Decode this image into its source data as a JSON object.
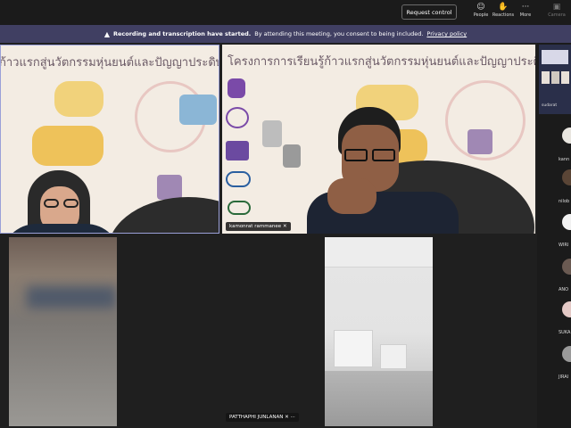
{
  "toolbar": {
    "request_control": "Request control",
    "people": "People",
    "reactions": "Reactions",
    "more": "More",
    "camera": "Camera"
  },
  "banner": {
    "bold_text": "Recording and transcription have started.",
    "text": "By attending this meeting, you consent to being included.",
    "link": "Privacy policy"
  },
  "slide_title": "โครงการการเรียนรู้ก้าวแรกสู่นวัตกรรมหุ่นยนต์และปัญญาประดิษฐ์",
  "slide_title_cropped": "ก้าวแรกสู่นวัตกรรมหุ่นยนต์และปัญญาประดิษฐ์",
  "participants": {
    "kamonrat": "kamonrat rammanee",
    "patthaphi": "PATTHAPHI JUNLANAN"
  },
  "rail": {
    "thumb_label": "sudarat",
    "people": [
      {
        "name": "kann",
        "color": "#e9e6e0"
      },
      {
        "name": "nilob",
        "color": "#5a4536"
      },
      {
        "name": "WIRI",
        "color": "#f2f2f2"
      },
      {
        "name": "ANO",
        "color": "#6a5a52"
      },
      {
        "name": "SUKA",
        "color": "#e4c9c6"
      },
      {
        "name": "JIRAI",
        "color": "#9a9a9a"
      }
    ]
  }
}
